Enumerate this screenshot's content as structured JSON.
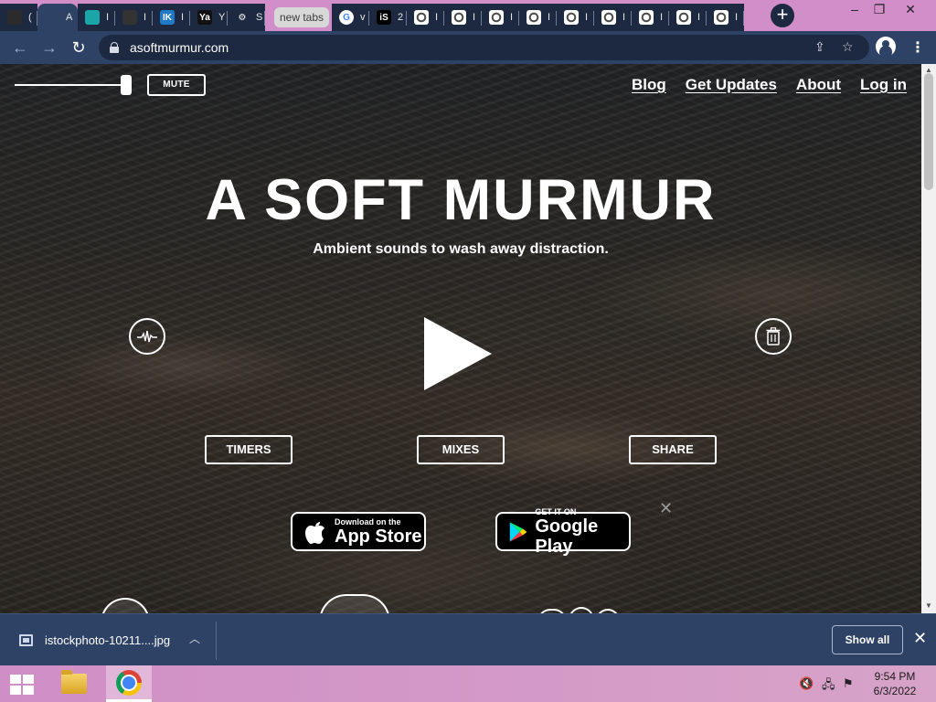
{
  "browser": {
    "tabs": [
      {
        "letter": "(",
        "favicon": "figma-like-icon",
        "fav_color": "#2b2b2b"
      },
      {
        "letter": "A",
        "favicon": "asoftmurmur-icon",
        "fav_color": "#2e4266",
        "active": true
      },
      {
        "letter": "I",
        "favicon": "pattern-icon",
        "fav_color": "#1aa6a6"
      },
      {
        "letter": "I",
        "favicon": "frame-icon",
        "fav_color": "#333333"
      },
      {
        "letter": "I",
        "favicon": "ik-icon",
        "fav_color": "#1f7ac7",
        "fav_text": "IK"
      },
      {
        "letter": "Y",
        "favicon": "yale-icon",
        "fav_color": "#111111",
        "fav_text": "Ya"
      },
      {
        "letter": "S",
        "favicon": "settings-gear-icon",
        "fav_color": "#1d2940",
        "fav_text": "⚙"
      }
    ],
    "group_label": "new tabs",
    "group_tabs": [
      {
        "letter": "v",
        "favicon": "google-icon",
        "fav_text": "G"
      },
      {
        "letter": "2",
        "favicon": "istock-icon",
        "fav_text": "iS"
      },
      {
        "letter": "I",
        "favicon": "chrome-icon"
      },
      {
        "letter": "I",
        "favicon": "chrome-icon"
      },
      {
        "letter": "I",
        "favicon": "chrome-icon"
      },
      {
        "letter": "I",
        "favicon": "chrome-icon"
      },
      {
        "letter": "I",
        "favicon": "chrome-icon"
      },
      {
        "letter": "I",
        "favicon": "chrome-icon"
      },
      {
        "letter": "I",
        "favicon": "chrome-icon"
      },
      {
        "letter": "I",
        "favicon": "chrome-icon"
      },
      {
        "letter": "I",
        "favicon": "chrome-icon"
      }
    ],
    "url": "asoftmurmur.com",
    "window_controls": {
      "minimize": "–",
      "restore": "❐",
      "close": "✕"
    }
  },
  "page": {
    "mute_label": "MUTE",
    "volume_level": 1.0,
    "nav_links": [
      "Blog",
      "Get Updates",
      "About",
      "Log in"
    ],
    "title": "A SOFT MURMUR",
    "subtitle": "Ambient sounds to wash away distraction.",
    "buttons": {
      "timers": "TIMERS",
      "mixes": "MIXES",
      "share": "SHARE"
    },
    "app_store": {
      "small": "Download on the",
      "big": "App Store"
    },
    "google_play": {
      "small": "GET IT ON",
      "big": "Google Play"
    }
  },
  "download_shelf": {
    "filename": "istockphoto-10211....jpg",
    "show_all_label": "Show all"
  },
  "taskbar": {
    "time": "9:54 PM",
    "date": "6/3/2022"
  }
}
